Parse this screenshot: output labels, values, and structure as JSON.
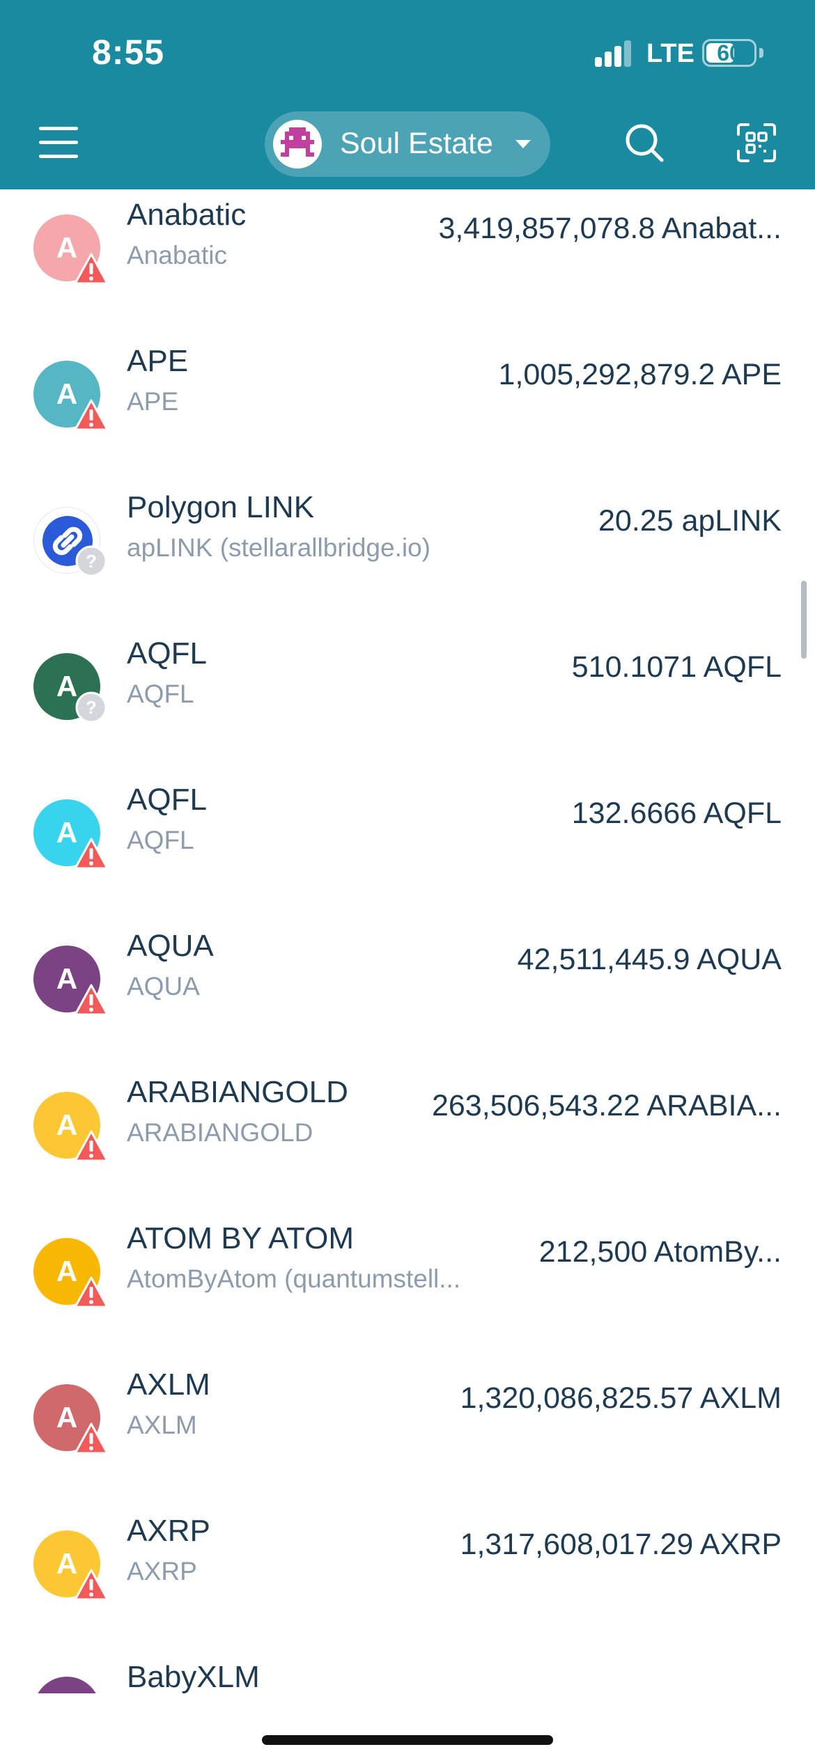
{
  "status_bar": {
    "time": "8:55",
    "network": "LTE",
    "battery": "60",
    "battery_level": 0.6
  },
  "header": {
    "account_name": "Soul Estate"
  },
  "colors": {
    "header_bg": "#1a8aa0",
    "warning": "#f25a5a",
    "unknown": "#d3d6da",
    "text_primary": "#1e3a52",
    "text_secondary": "#8c9bad"
  },
  "assets": [
    {
      "code": "Anabatic",
      "domain": "Anabatic",
      "balance": "3,419,857,078.8 Anabat...",
      "avatar_letter": "A",
      "avatar_color": "#f4a8ab",
      "badge": "warning-icon"
    },
    {
      "code": "APE",
      "domain": "APE",
      "balance": "1,005,292,879.2 APE",
      "avatar_letter": "A",
      "avatar_color": "#55b6c4",
      "badge": "warning-icon"
    },
    {
      "code": "Polygon LINK",
      "domain": "apLINK (stellarallbridge.io)",
      "balance": "20.25 apLINK",
      "avatar_letter": "",
      "avatar_color": "#2a5ad7",
      "badge": "question-icon",
      "icon": "link-icon"
    },
    {
      "code": "AQFL",
      "domain": "AQFL",
      "balance": "510.1071 AQFL",
      "avatar_letter": "A",
      "avatar_color": "#2d7155",
      "badge": "question-icon"
    },
    {
      "code": "AQFL",
      "domain": "AQFL",
      "balance": "132.6666 AQFL",
      "avatar_letter": "A",
      "avatar_color": "#38d3ec",
      "badge": "warning-icon"
    },
    {
      "code": "AQUA",
      "domain": "AQUA",
      "balance": "42,511,445.9 AQUA",
      "avatar_letter": "A",
      "avatar_color": "#7b4384",
      "badge": "warning-icon"
    },
    {
      "code": "ARABIANGOLD",
      "domain": "ARABIANGOLD",
      "balance": "263,506,543.22 ARABIA...",
      "avatar_letter": "A",
      "avatar_color": "#fbc732",
      "badge": "warning-icon"
    },
    {
      "code": "ATOM BY ATOM",
      "domain": "AtomByAtom (quantumstell...",
      "balance": "212,500 AtomBy...",
      "avatar_letter": "A",
      "avatar_color": "#f7b702",
      "badge": "warning-icon"
    },
    {
      "code": "AXLM",
      "domain": "AXLM",
      "balance": "1,320,086,825.57 AXLM",
      "avatar_letter": "A",
      "avatar_color": "#d06a6a",
      "badge": "warning-icon"
    },
    {
      "code": "AXRP",
      "domain": "AXRP",
      "balance": "1,317,608,017.29 AXRP",
      "avatar_letter": "A",
      "avatar_color": "#fbc732",
      "badge": "warning-icon"
    },
    {
      "code": "BabyXLM",
      "domain": "",
      "balance": "",
      "avatar_letter": "",
      "avatar_color": "#7b4384",
      "badge": ""
    }
  ]
}
